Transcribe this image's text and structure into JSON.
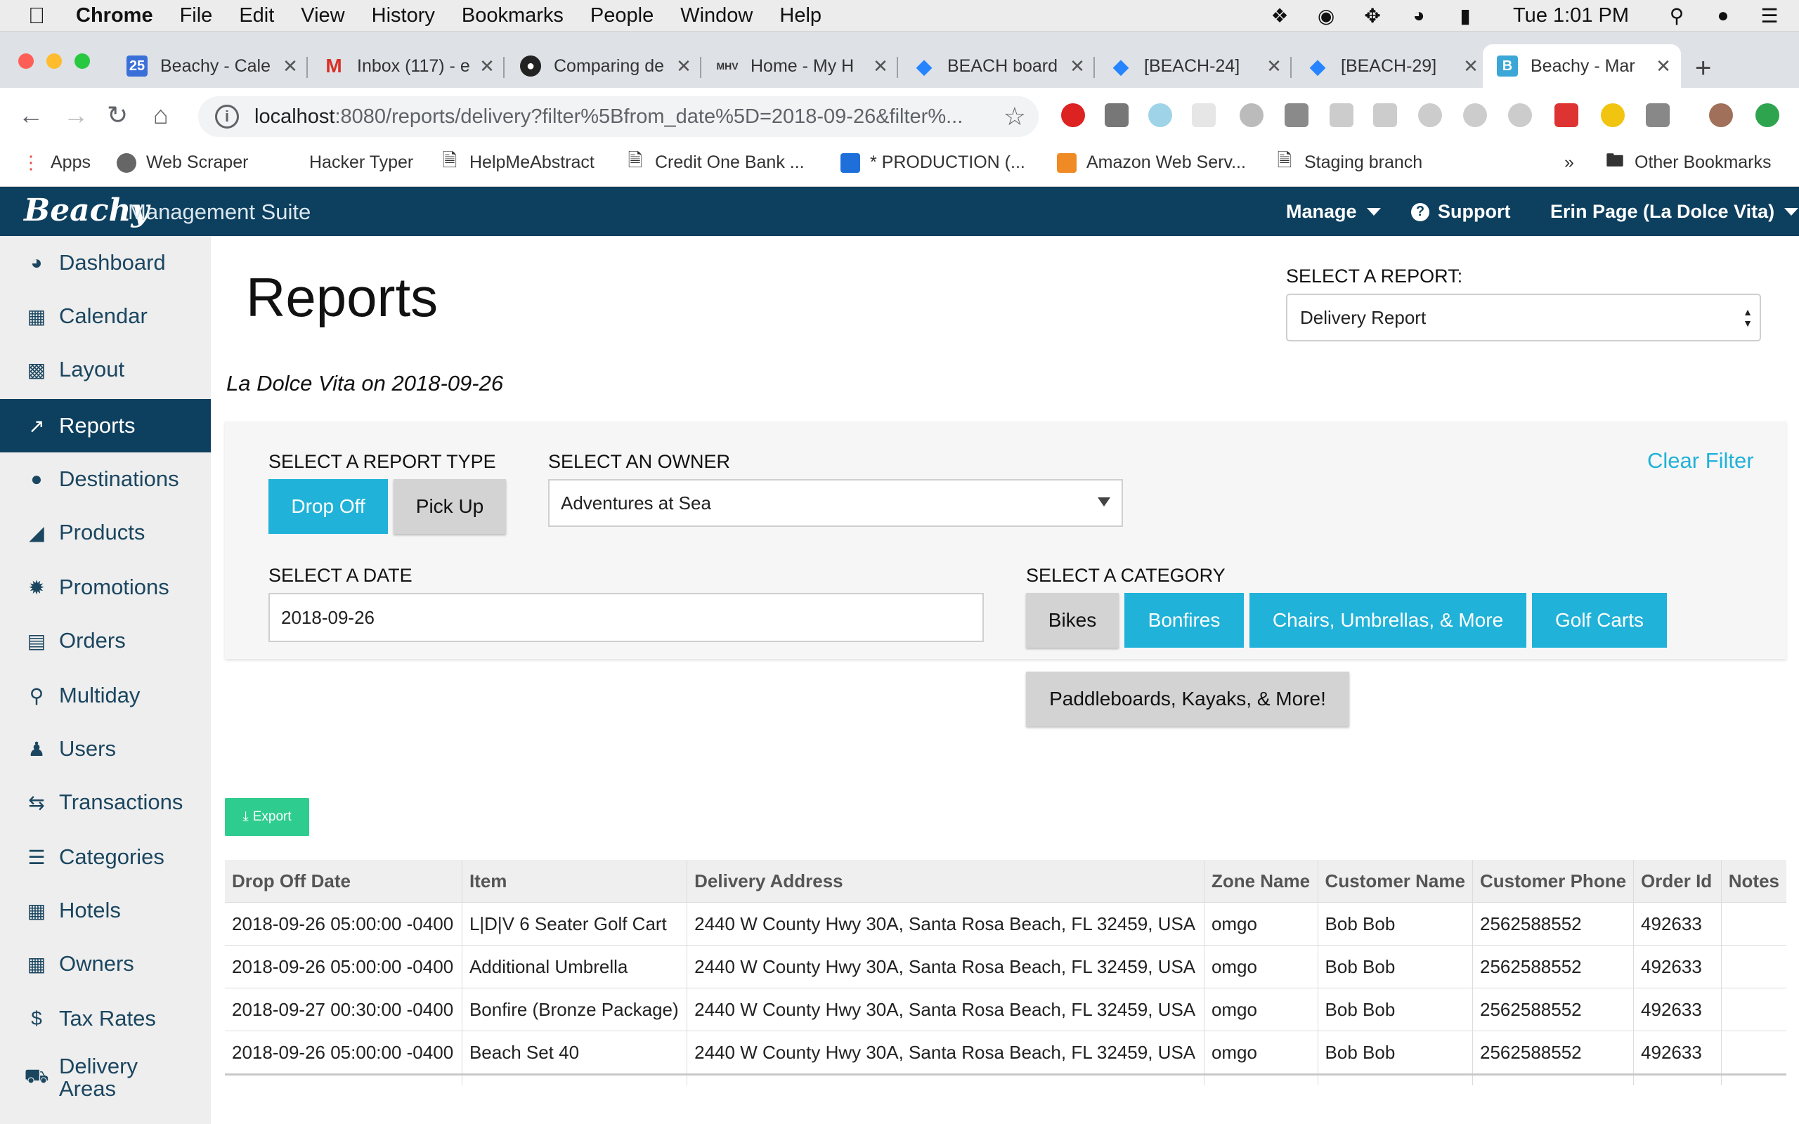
{
  "macbar": {
    "app_name": "Chrome",
    "menus": [
      "File",
      "Edit",
      "View",
      "History",
      "Bookmarks",
      "People",
      "Window",
      "Help"
    ],
    "clock": "Tue 1:01 PM"
  },
  "tabs": [
    {
      "label": "Beachy - Cale",
      "icon": "calendar-icon",
      "color": "#3b6fd8"
    },
    {
      "label": "Inbox (117) - e",
      "icon": "gmail-icon",
      "color": "#d93025"
    },
    {
      "label": "Comparing de",
      "icon": "github-icon",
      "color": "#222222"
    },
    {
      "label": "Home - My H",
      "icon": "mhv-icon",
      "color": "#333333"
    },
    {
      "label": "BEACH board",
      "icon": "jira-icon",
      "color": "#2684ff"
    },
    {
      "label": "[BEACH-24]",
      "icon": "jira-icon",
      "color": "#2684ff"
    },
    {
      "label": "[BEACH-29]",
      "icon": "jira-icon",
      "color": "#2684ff"
    },
    {
      "label": "Beachy - Mar",
      "icon": "beachy-icon",
      "color": "#3aa7d6"
    }
  ],
  "omnibox": {
    "host": "localhost",
    "rest": ":8080/reports/delivery?filter%5Bfrom_date%5D=2018-09-26&filter%..."
  },
  "bookmarks": [
    {
      "label": "Apps"
    },
    {
      "label": "Web Scraper"
    },
    {
      "label": "Hacker Typer"
    },
    {
      "label": "HelpMeAbstract"
    },
    {
      "label": "Credit One Bank ..."
    },
    {
      "label": "* PRODUCTION (..."
    },
    {
      "label": "Amazon Web Serv..."
    },
    {
      "label": "Staging branch"
    },
    {
      "label": "»"
    },
    {
      "label": "Other Bookmarks"
    }
  ],
  "header": {
    "brand": "Beachy",
    "subtitle": "Management Suite",
    "manage": "Manage",
    "support": "Support",
    "user": "Erin Page (La Dolce Vita)"
  },
  "sidebar": {
    "items": [
      {
        "label": "Dashboard",
        "icon": "dashboard-icon"
      },
      {
        "label": "Calendar",
        "icon": "calendar-icon"
      },
      {
        "label": "Layout",
        "icon": "grid-icon"
      },
      {
        "label": "Reports",
        "icon": "line-chart-icon"
      },
      {
        "label": "Destinations",
        "icon": "map-pin-icon"
      },
      {
        "label": "Products",
        "icon": "tag-icon"
      },
      {
        "label": "Promotions",
        "icon": "badge-icon"
      },
      {
        "label": "Orders",
        "icon": "credit-card-icon"
      },
      {
        "label": "Multiday",
        "icon": "search-icon"
      },
      {
        "label": "Users",
        "icon": "user-icon"
      },
      {
        "label": "Transactions",
        "icon": "exchange-icon"
      },
      {
        "label": "Categories",
        "icon": "list-icon"
      },
      {
        "label": "Hotels",
        "icon": "building-icon"
      },
      {
        "label": "Owners",
        "icon": "building-icon"
      },
      {
        "label": "Tax Rates",
        "icon": "dollar-icon"
      },
      {
        "label": "Delivery Areas",
        "icon": "truck-icon"
      }
    ]
  },
  "main": {
    "title": "Reports",
    "report_select_label": "SELECT A REPORT:",
    "report_selected": "Delivery Report",
    "subtitle": "La Dolce Vita on 2018-09-26",
    "filters": {
      "report_type_label": "SELECT A REPORT TYPE",
      "drop_off": "Drop Off",
      "pick_up": "Pick Up",
      "owner_label": "SELECT AN OWNER",
      "owner_selected": "Adventures at Sea",
      "clear_filter": "Clear Filter",
      "date_label": "SELECT A DATE",
      "date_value": "2018-09-26",
      "category_label": "SELECT A CATEGORY",
      "categories": [
        "Bikes",
        "Bonfires",
        "Chairs, Umbrellas, & More",
        "Golf Carts",
        "Paddleboards, Kayaks, & More!"
      ]
    },
    "export_label": "Export",
    "table": {
      "headers": [
        "Drop Off Date",
        "Item",
        "Delivery Address",
        "Zone Name",
        "Customer Name",
        "Customer Phone",
        "Order Id",
        "Notes"
      ],
      "rows": [
        [
          "2018-09-26 05:00:00 -0400",
          "L|D|V 6 Seater Golf Cart",
          "2440 W County Hwy 30A, Santa Rosa Beach, FL 32459, USA",
          "omgo",
          "Bob Bob",
          "2562588552",
          "492633",
          ""
        ],
        [
          "2018-09-26 05:00:00 -0400",
          "Additional Umbrella",
          "2440 W County Hwy 30A, Santa Rosa Beach, FL 32459, USA",
          "omgo",
          "Bob Bob",
          "2562588552",
          "492633",
          ""
        ],
        [
          "2018-09-27 00:30:00 -0400",
          "Bonfire (Bronze Package)",
          "2440 W County Hwy 30A, Santa Rosa Beach, FL 32459, USA",
          "omgo",
          "Bob Bob",
          "2562588552",
          "492633",
          ""
        ],
        [
          "2018-09-26 05:00:00 -0400",
          "Beach Set 40",
          "2440 W County Hwy 30A, Santa Rosa Beach, FL 32459, USA",
          "omgo",
          "Bob Bob",
          "2562588552",
          "492633",
          ""
        ]
      ]
    }
  },
  "colors": {
    "navy": "#0d3f5e",
    "accent": "#20b2d8",
    "export": "#2ecc8f"
  }
}
